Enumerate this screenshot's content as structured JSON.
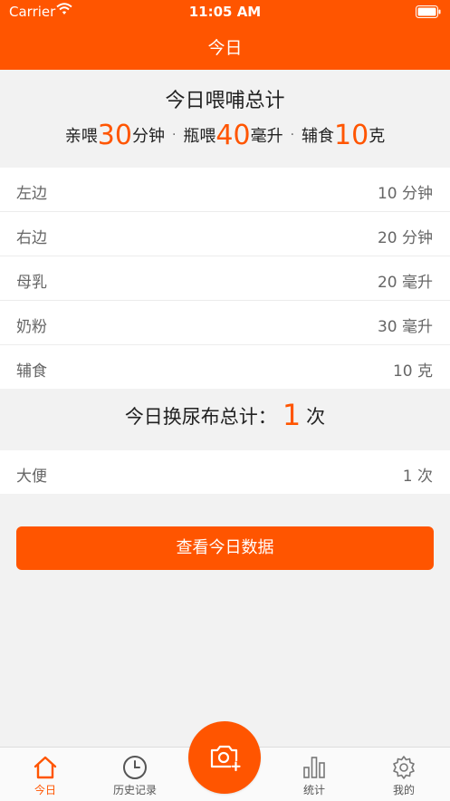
{
  "status_bar": {
    "carrier": "Carrier",
    "time": "11:05 AM"
  },
  "nav": {
    "title": "今日"
  },
  "summary": {
    "title": "今日喂哺总计",
    "breast_label": "亲喂",
    "breast_value": "30",
    "breast_unit": "分钟",
    "bottle_label": "瓶喂",
    "bottle_value": "40",
    "bottle_unit": "毫升",
    "solid_label": "辅食",
    "solid_value": "10",
    "solid_unit": "克",
    "separator": "·"
  },
  "feeding_rows": [
    {
      "label": "左边",
      "value": "10 分钟"
    },
    {
      "label": "右边",
      "value": "20 分钟"
    },
    {
      "label": "母乳",
      "value": "20 毫升"
    },
    {
      "label": "奶粉",
      "value": "30 毫升"
    },
    {
      "label": "辅食",
      "value": "10 克"
    }
  ],
  "diaper": {
    "prefix": "今日换尿布总计：",
    "count": "1",
    "suffix": "次"
  },
  "diaper_rows": [
    {
      "label": "大便",
      "value": "1 次"
    }
  ],
  "button": {
    "label": "查看今日数据"
  },
  "tabs": [
    {
      "label": "今日"
    },
    {
      "label": "历史记录"
    },
    {
      "label": "统计"
    },
    {
      "label": "我的"
    }
  ],
  "colors": {
    "accent": "#ff5500"
  }
}
